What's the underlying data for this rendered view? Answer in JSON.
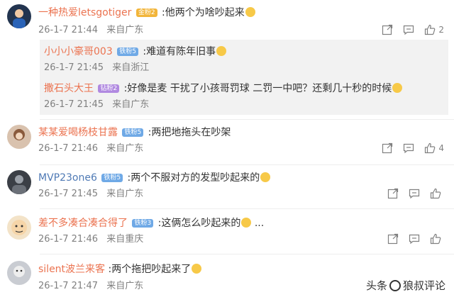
{
  "comments": [
    {
      "username": "一种热爱letsgotiger",
      "badge": "金粉2",
      "text": ":他两个为啥吵起来",
      "time": "26-1-7 21:44",
      "location": "来自广东",
      "likes": "2",
      "replies": [
        {
          "username": "小小小豪哥003",
          "badge": "铁粉5",
          "text": ":难道有陈年旧事",
          "time": "26-1-7 21:45",
          "location": "来自浙江"
        },
        {
          "username": "撒石头大王",
          "badge": "钻粉2",
          "text": ":好像是麦 干扰了小孩哥罚球 二罚一中吧？还剩几十秒的时候",
          "time": "26-1-7 21:45",
          "location": "来自广东"
        }
      ]
    },
    {
      "username": "某某爱喝杨枝甘露",
      "badge": "铁粉5",
      "text": ":两把地拖头在吵架",
      "time": "26-1-7 21:46",
      "location": "来自广东",
      "likes": "4"
    },
    {
      "username": "MVP23one6",
      "badge": "铁粉5",
      "text": ":两个不服对方的发型吵起来的",
      "time": "26-1-7 21:45",
      "location": "来自广东",
      "likes": ""
    },
    {
      "username": "差不多凑合凑合得了",
      "badge": "铁粉3",
      "text": ":这俩怎么吵起来的",
      "time": "26-1-7 21:46",
      "location": "来自重庆",
      "likes": ""
    },
    {
      "username": "silent波兰来客",
      "text": ":两个拖把吵起来了",
      "time": "26-1-7 21:47",
      "location": "来自广东"
    }
  ],
  "ellipsis": "...",
  "watermark": {
    "prefix": "头条",
    "suffix": "狼叔评论"
  },
  "colors": {
    "username": "#eb7350",
    "meta": "#808080",
    "reply_bg": "#f2f2f2"
  }
}
